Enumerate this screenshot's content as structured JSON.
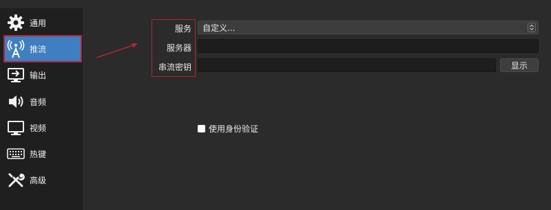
{
  "sidebar": {
    "items": [
      {
        "label": "通用",
        "icon": "gear-icon"
      },
      {
        "label": "推流",
        "icon": "broadcast-antenna-icon"
      },
      {
        "label": "输出",
        "icon": "output-monitor-icon"
      },
      {
        "label": "音频",
        "icon": "speaker-icon"
      },
      {
        "label": "视频",
        "icon": "monitor-icon"
      },
      {
        "label": "热键",
        "icon": "keyboard-icon"
      },
      {
        "label": "高级",
        "icon": "tools-icon"
      }
    ],
    "active_index": 1,
    "active_color": "#3f7ec1"
  },
  "stream": {
    "service_label": "服务",
    "service_value": "自定义...",
    "server_label": "服务器",
    "server_value": "",
    "key_label": "串流密钥",
    "key_value": "",
    "show_button_label": "显示",
    "auth_checkbox_label": "使用身份验证",
    "auth_checked": false
  },
  "annotation": {
    "highlight_color": "#b0263a"
  }
}
